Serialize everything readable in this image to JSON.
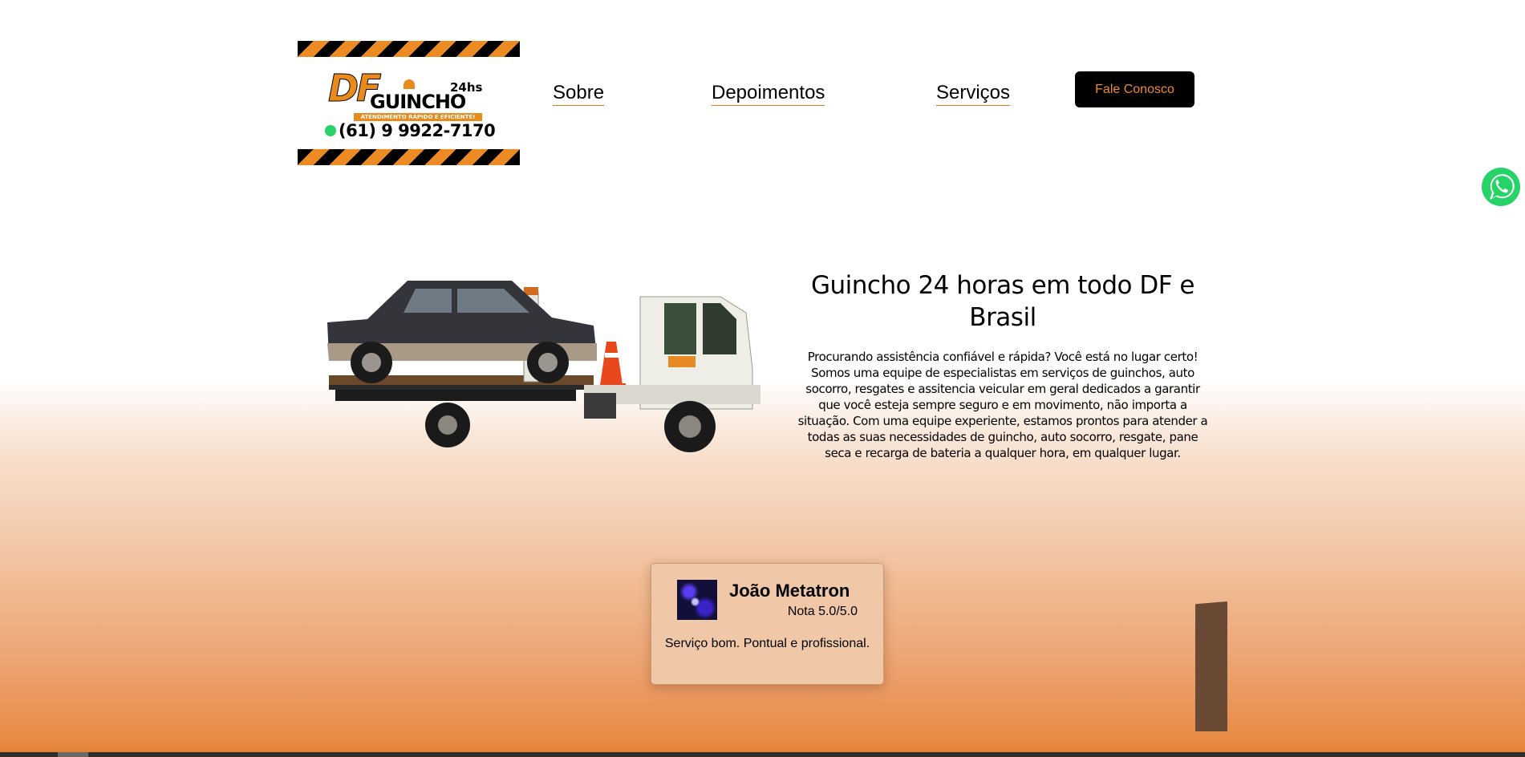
{
  "brand": {
    "logo_mark": "DF",
    "logo_hours": "24hs",
    "logo_name": "GUINCHO",
    "logo_tagline": "ATENDIMENTO RÁPIDO E EFICIENTE!",
    "logo_phone": "(61) 9 9922-7170"
  },
  "nav": {
    "items": [
      {
        "label": "Sobre"
      },
      {
        "label": "Depoimentos"
      },
      {
        "label": "Serviços"
      }
    ],
    "cta_label": "Fale Conosco"
  },
  "hero": {
    "title": "Guincho 24 horas em todo DF e Brasil",
    "text": "Procurando assistência confiável e rápida? Você está no lugar certo! Somos uma equipe de especialistas em serviços de guinchos, auto socorro, resgates e assitencia veicular em geral dedicados a garantir que você esteja sempre seguro e em movimento, não importa a situação. Com uma equipe experiente, estamos prontos para atender a todas as suas necessidades de guincho, auto socorro, resgate, pane seca e recarga de bateria a qualquer hora, em qualquer lugar."
  },
  "testimonial": {
    "name": "João Metatron",
    "rating": "Nota 5.0/5.0",
    "quote": "Serviço bom. Pontual e profissional."
  },
  "icons": {
    "floating_button": "whatsapp-icon",
    "logo_phone_icon": "whatsapp-icon"
  },
  "colors": {
    "accent_orange": "#e88a23",
    "cta_background": "#000000",
    "cta_text": "#ee8a2c",
    "whatsapp_green": "#25d366",
    "card_background": "#f0c8a8"
  }
}
